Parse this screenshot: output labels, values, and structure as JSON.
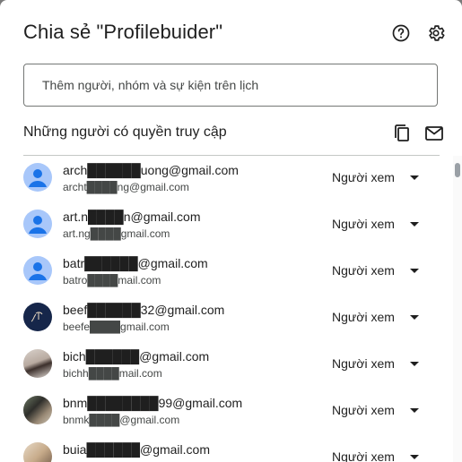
{
  "dialog": {
    "title": "Chia sẻ \"Profilebuider\"",
    "add_people_placeholder": "Thêm người, nhóm và sự kiện trên lịch",
    "access_section_title": "Những người có quyền truy cập"
  },
  "people": [
    {
      "email": "arch██████uong@gmail.com",
      "sub": "archt████ng@gmail.com",
      "role": "Người xem",
      "avatar": "default"
    },
    {
      "email": "art.n████n@gmail.com",
      "sub": "art.ng████gmail.com",
      "role": "Người xem",
      "avatar": "default"
    },
    {
      "email": "batr██████@gmail.com",
      "sub": "batro████mail.com",
      "role": "Người xem",
      "avatar": "default"
    },
    {
      "email": "beef██████32@gmail.com",
      "sub": "beefe████gmail.com",
      "role": "Người xem",
      "avatar": "dark"
    },
    {
      "email": "bich██████@gmail.com",
      "sub": "bichh████mail.com",
      "role": "Người xem",
      "avatar": "photo1"
    },
    {
      "email": "bnm████████99@gmail.com",
      "sub": "bnmk████@gmail.com",
      "role": "Người xem",
      "avatar": "photo2"
    },
    {
      "email": "buia██████@gmail.com",
      "sub": "",
      "role": "Người xem",
      "avatar": "photo3"
    }
  ],
  "colors": {
    "avatar_default": "#a8c7fa",
    "avatar_person": "#1a73e8",
    "divider": "#c4c7c5",
    "input_border": "#747775"
  },
  "icons": {
    "help": "help-circle-icon",
    "settings": "gear-icon",
    "copy": "copy-icon",
    "mail": "mail-icon",
    "role_dropdown": "caret-down-icon"
  }
}
